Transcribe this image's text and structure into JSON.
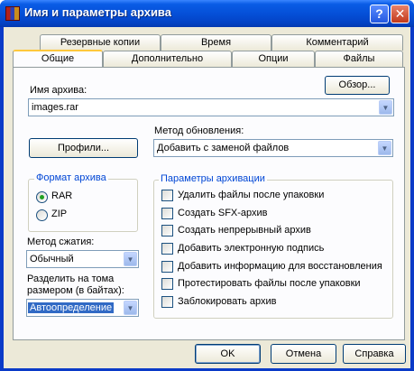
{
  "window": {
    "title": "Имя и параметры архива",
    "help_glyph": "?",
    "close_glyph": "✕"
  },
  "tabs_back": [
    "Резервные копии",
    "Время",
    "Комментарий"
  ],
  "tabs_front": [
    "Общие",
    "Дополнительно",
    "Опции",
    "Файлы"
  ],
  "archive_name": {
    "label": "Имя архива:",
    "value": "images.rar",
    "browse_label": "Обзор..."
  },
  "update_method": {
    "label": "Метод обновления:",
    "value": "Добавить с заменой файлов"
  },
  "profiles_label": "Профили...",
  "format": {
    "title": "Формат архива",
    "options": [
      "RAR",
      "ZIP"
    ],
    "selected": "RAR"
  },
  "compression": {
    "label": "Метод сжатия:",
    "value": "Обычный"
  },
  "split": {
    "label_line1": "Разделить на тома",
    "label_line2": "размером (в байтах):",
    "value": "Автоопределение"
  },
  "archive_params": {
    "title": "Параметры архивации",
    "items": [
      "Удалить файлы после упаковки",
      "Создать SFX-архив",
      "Создать непрерывный архив",
      "Добавить электронную подпись",
      "Добавить информацию для восстановления",
      "Протестировать файлы после упаковки",
      "Заблокировать архив"
    ]
  },
  "buttons": {
    "ok": "OK",
    "cancel": "Отмена",
    "help": "Справка"
  },
  "dropdown_glyph": "▼"
}
